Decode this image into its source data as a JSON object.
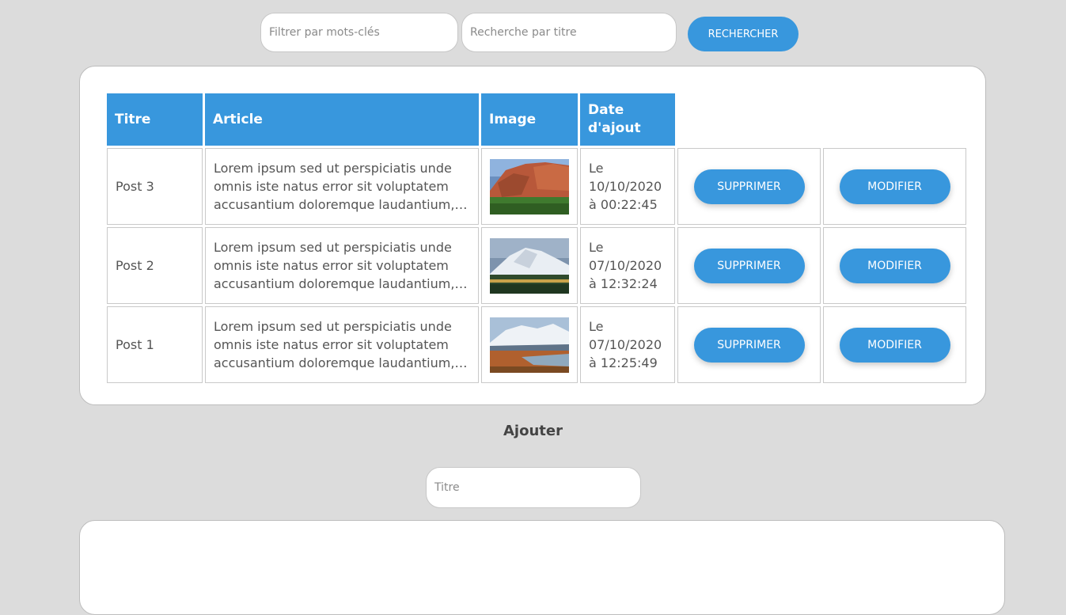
{
  "search": {
    "keywords_placeholder": "Filtrer par mots-clés",
    "title_placeholder": "Recherche par titre",
    "button_label": "RECHERCHER"
  },
  "table": {
    "headers": [
      "Titre",
      "Article",
      "Image",
      "Date d'ajout"
    ],
    "rows": [
      {
        "title": "Post 3",
        "article": "Lorem ipsum sed ut perspiciatis unde omnis iste natus error sit voluptatem accusantium doloremque laudantium, totam rem aperiam",
        "date": "Le 10/10/2020 à 00:22:45",
        "image": "red-rock-canyon-photo",
        "delete_label": "SUPPRIMER",
        "edit_label": "MODIFIER"
      },
      {
        "title": "Post 2",
        "article": "Lorem ipsum sed ut perspiciatis unde omnis iste natus error sit voluptatem accusantium doloremque laudantium, totam rem aperiam",
        "date": "Le 07/10/2020 à 12:32:24",
        "image": "snowy-mountain-forest-photo",
        "delete_label": "SUPPRIMER",
        "edit_label": "MODIFIER"
      },
      {
        "title": "Post 1",
        "article": "Lorem ipsum sed ut perspiciatis unde omnis iste natus error sit voluptatem accusantium doloremque laudantium, totam rem aperiam",
        "date": "Le 07/10/2020 à 12:25:49",
        "image": "mountain-lake-autumn-photo",
        "delete_label": "SUPPRIMER",
        "edit_label": "MODIFIER"
      }
    ]
  },
  "add_form": {
    "heading": "Ajouter",
    "title_placeholder": "Titre"
  },
  "colors": {
    "accent": "#3897dd",
    "background": "#dcdcdc",
    "card": "#ffffff"
  }
}
